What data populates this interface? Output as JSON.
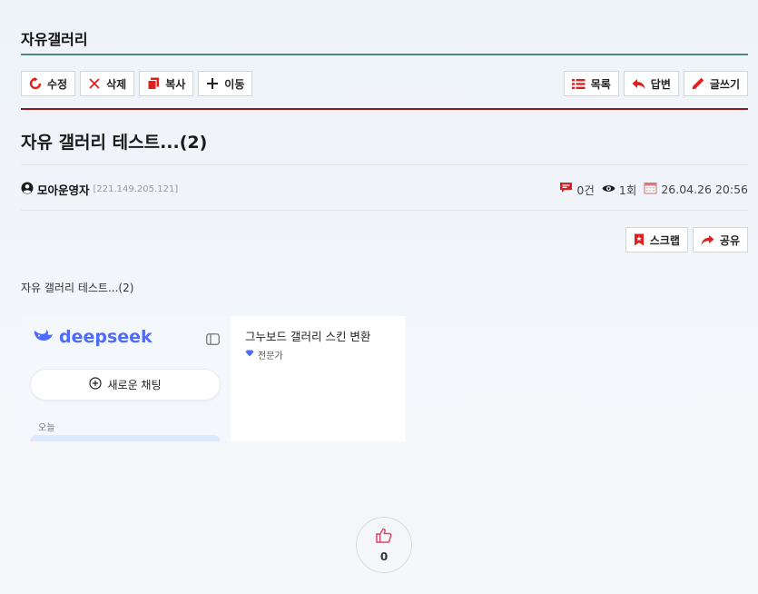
{
  "board": {
    "title": "자유갤러리"
  },
  "toolbar_left": [
    {
      "id": "edit",
      "label": "수정",
      "icon": "refresh-icon"
    },
    {
      "id": "delete",
      "label": "삭제",
      "icon": "close-icon"
    },
    {
      "id": "copy",
      "label": "복사",
      "icon": "copy-icon"
    },
    {
      "id": "move",
      "label": "이동",
      "icon": "move-icon"
    }
  ],
  "toolbar_right": [
    {
      "id": "list",
      "label": "목록",
      "icon": "list-icon"
    },
    {
      "id": "reply",
      "label": "답변",
      "icon": "reply-icon"
    },
    {
      "id": "write",
      "label": "글쓰기",
      "icon": "pencil-icon"
    }
  ],
  "post": {
    "title": "자유 갤러리 테스트...(2)",
    "author": "모아운영자",
    "ip": "[221.149.205.121]",
    "comments": "0건",
    "views": "1회",
    "date": "26.04.26 20:56",
    "body": "자유 갤러리 테스트...(2)"
  },
  "post_actions": [
    {
      "id": "scrap",
      "label": "스크랩",
      "icon": "bookmark-icon"
    },
    {
      "id": "share",
      "label": "공유",
      "icon": "share-icon"
    }
  ],
  "embed": {
    "logo_text": "deepseek",
    "new_chat": "새로운 채팅",
    "today": "오늘",
    "card_title": "그누보드 갤러리 스킨 변환",
    "card_sub": "전문가"
  },
  "like": {
    "count": "0"
  },
  "colors": {
    "accent_red": "#e01f1f",
    "title_line": "#4a8b7f",
    "red_line": "#8c1a1a",
    "deepseek_blue": "#4d6bfe"
  }
}
